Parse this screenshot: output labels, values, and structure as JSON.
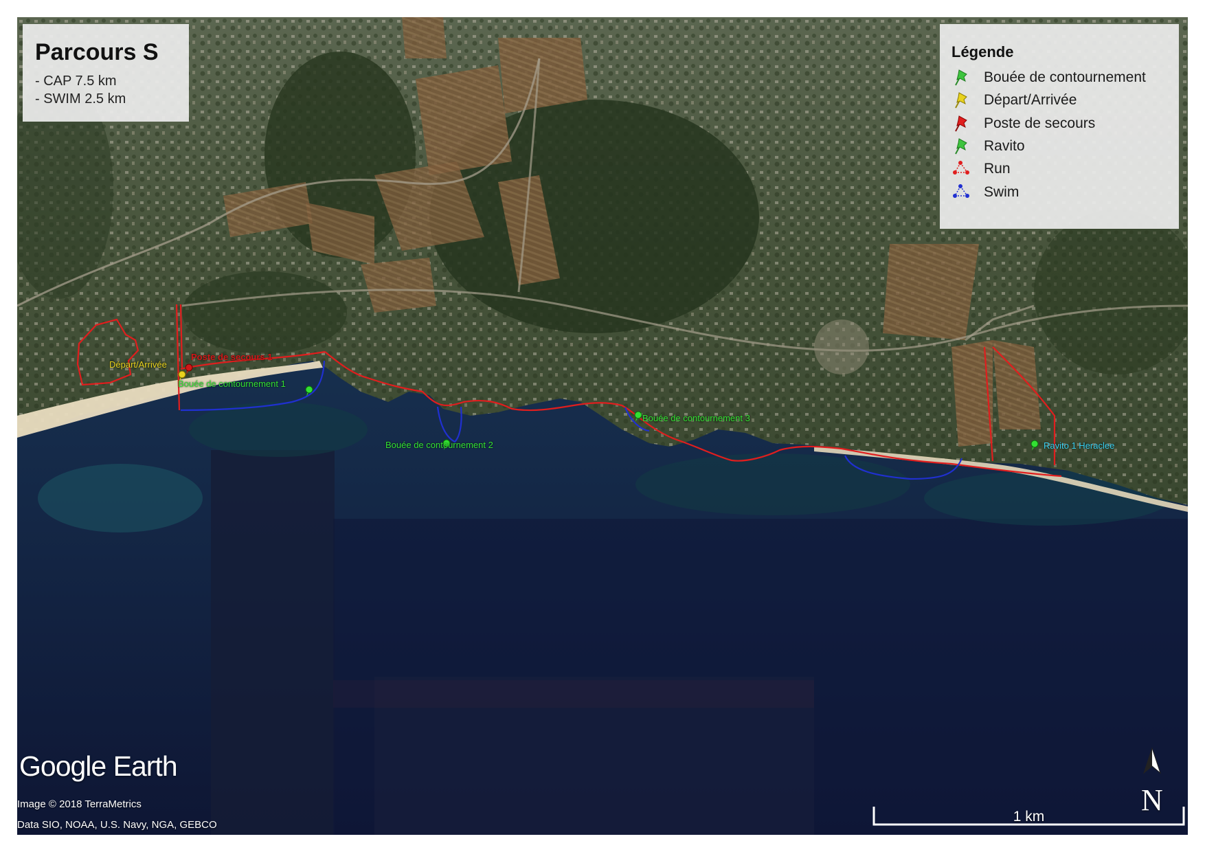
{
  "title_panel": {
    "title": "Parcours S",
    "lines": [
      "- CAP 7.5 km",
      "- SWIM 2.5 km"
    ]
  },
  "legend": {
    "title": "Légende",
    "items": [
      {
        "label": "Bouée de contournement",
        "symbol": "green-pushpin-icon",
        "color": "#3ec43e"
      },
      {
        "label": "Départ/Arrivée",
        "symbol": "yellow-pushpin-icon",
        "color": "#e8d21e"
      },
      {
        "label": "Poste de secours",
        "symbol": "red-pushpin-icon",
        "color": "#e01e1e"
      },
      {
        "label": "Ravito",
        "symbol": "green-pushpin-icon",
        "color": "#3ec43e"
      },
      {
        "label": "Run",
        "symbol": "red-route-icon",
        "color": "#e01e1e"
      },
      {
        "label": "Swim",
        "symbol": "blue-route-icon",
        "color": "#2030d0"
      }
    ]
  },
  "markers": [
    {
      "label": "Départ/Arrivée",
      "color": "#e8d21e"
    },
    {
      "label": "Poste de secours 1",
      "color": "#d01818"
    },
    {
      "label": "Bouée de contournement 1",
      "color": "#33e033"
    },
    {
      "label": "Bouée de contournement 2",
      "color": "#33e033"
    },
    {
      "label": "Bouée de contournement 3",
      "color": "#33e033"
    },
    {
      "label": "Ravito 1 Heraclee",
      "color": "#3ad0f0"
    }
  ],
  "attribution": {
    "logo_google": "Google",
    "logo_earth": "Earth",
    "image_credit": "Image © 2018 TerraMetrics",
    "data_credit": "Data SIO, NOAA, U.S. Navy, NGA, GEBCO"
  },
  "north_arrow": {
    "label": "N"
  },
  "scale_bar": {
    "label": "1 km"
  },
  "colors": {
    "run": "#e01e1e",
    "swim": "#2030d0",
    "land": "#3a4a2e",
    "sea_shallow": "#2a7f8a",
    "sea_deep": "#101a3a"
  }
}
